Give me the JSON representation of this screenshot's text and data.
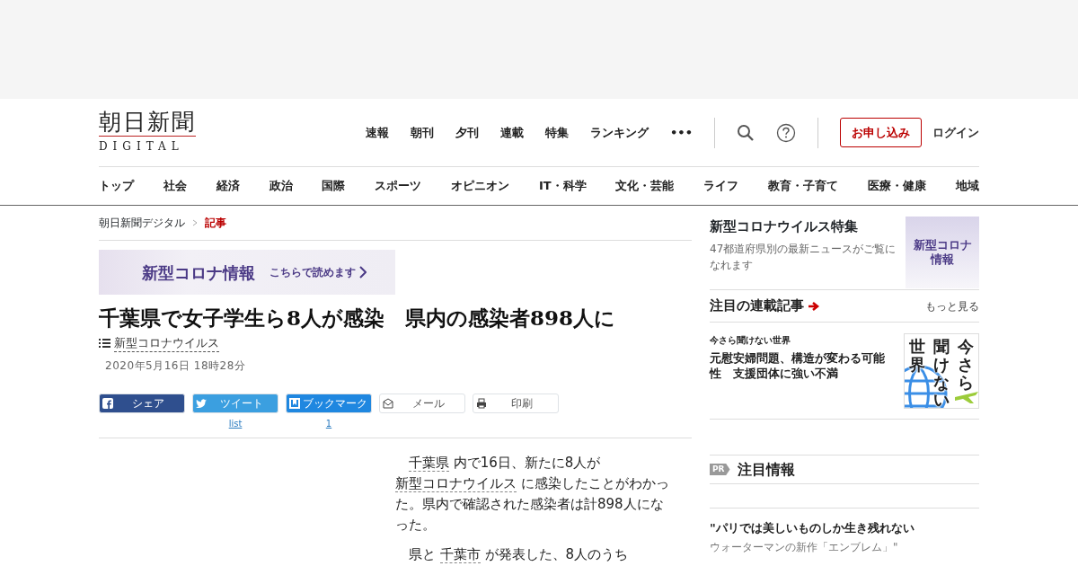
{
  "header": {
    "logo": {
      "title": "朝日新聞",
      "subtitle": "DIGITAL"
    },
    "top_nav": [
      "速報",
      "朝刊",
      "夕刊",
      "連載",
      "特集",
      "ランキング"
    ],
    "more": "•••",
    "signup": "お申し込み",
    "login": "ログイン"
  },
  "category_nav": [
    "トップ",
    "社会",
    "経済",
    "政治",
    "国際",
    "スポーツ",
    "オピニオン",
    "IT・科学",
    "文化・芸能",
    "ライフ",
    "教育・子育て",
    "医療・健康",
    "地域"
  ],
  "breadcrumb": [
    {
      "label": "朝日新聞デジタル",
      "current": false
    },
    {
      "label": "記事",
      "current": true
    }
  ],
  "banner": {
    "title": "新型コロナ情報",
    "link": "こちらで読めます"
  },
  "article": {
    "title": "千葉県で女子学生ら8人が感染　県内の感染者898人に",
    "topic": "新型コロナウイルス",
    "date": "2020年5月16日 18時28分",
    "share": [
      {
        "kind": "facebook",
        "label": "シェア"
      },
      {
        "kind": "twitter",
        "label": "ツイート",
        "count": "list"
      },
      {
        "kind": "hatena",
        "label": "ブックマーク",
        "count": "1"
      },
      {
        "kind": "mail",
        "label": "メール"
      },
      {
        "kind": "print",
        "label": "印刷"
      }
    ],
    "paragraphs": [
      [
        {
          "text": "千葉県",
          "link": true
        },
        {
          "text": " 内で16日、新たに8人が ",
          "link": false
        },
        {
          "text": "新型コロナウイルス",
          "link": true
        },
        {
          "text": " に感染したことがわかった。県内で確認された感染者は計898人になった。",
          "link": false
        }
      ],
      [
        {
          "text": "県と ",
          "link": false
        },
        {
          "text": "千葉市",
          "link": true
        },
        {
          "text": " が発表した、8人のうち",
          "link": false
        }
      ]
    ]
  },
  "sidebar": {
    "feature": {
      "title": "新型コロナウイルス特集",
      "description": "47都道府県別の最新ニュースがご覧になれます",
      "thumb_lines": [
        "新型コロナ",
        "情報"
      ]
    },
    "series": {
      "heading": "注目の連載記事",
      "more": "もっと見る",
      "items": [
        {
          "series": "今さら聞けない世界",
          "title": "元慰安婦問題、構造が変わる可能性　支援団体に強い不満",
          "thumb_columns": [
            "世界",
            "聞けない",
            "今さら"
          ]
        }
      ]
    },
    "pr": {
      "badge": "PR",
      "heading": "注目情報",
      "items": [
        {
          "title": "\"パリでは美しいものしか生き残れない",
          "subtitle": "ウォーターマンの新作「エンブレム」\""
        }
      ]
    }
  }
}
